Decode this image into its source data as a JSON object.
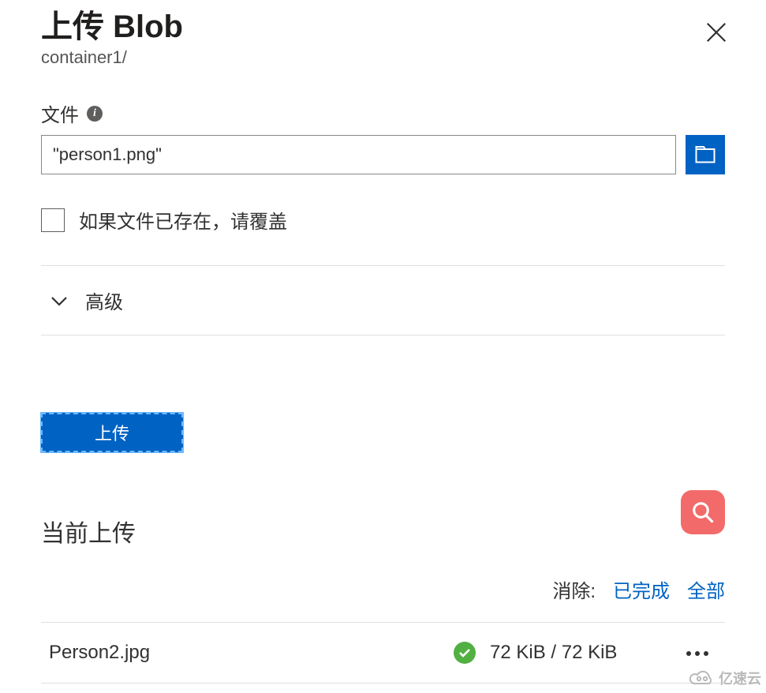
{
  "header": {
    "title": "上传 Blob",
    "subtitle": "container1/"
  },
  "file_field": {
    "label": "文件",
    "info_icon": "info-icon",
    "value": "\"person1.png\"",
    "browse_icon": "folder-open-icon"
  },
  "overwrite": {
    "checked": false,
    "label": "如果文件已存在，请覆盖"
  },
  "advanced": {
    "label": "高级",
    "expanded": false
  },
  "upload_button": {
    "label": "上传"
  },
  "current_uploads": {
    "title": "当前上传",
    "dismiss_label": "消除:",
    "dismiss_completed": "已完成",
    "dismiss_all": "全部",
    "items": [
      {
        "name": "Person2.jpg",
        "status": "success",
        "size": "72 KiB / 72 KiB"
      }
    ]
  },
  "search_fab_icon": "search-icon",
  "watermark": "亿速云",
  "colors": {
    "primary": "#0062c3",
    "link": "#0062c3",
    "success": "#52b043",
    "fab": "#f36a6a",
    "border": "#e1dfdd"
  }
}
